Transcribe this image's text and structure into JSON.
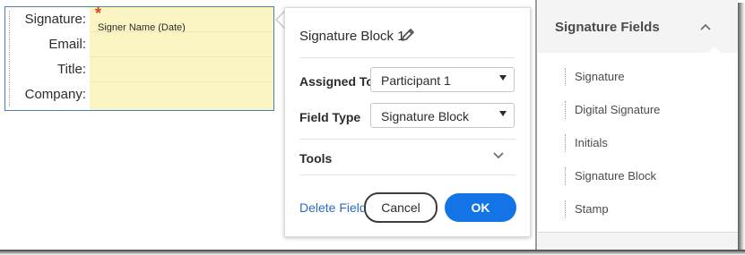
{
  "signature_block": {
    "rows": [
      {
        "label": "Signature:",
        "placeholder": "Signer Name (Date)",
        "required_marker": "*"
      },
      {
        "label": "Email:"
      },
      {
        "label": "Title:"
      },
      {
        "label": "Company:"
      }
    ]
  },
  "panel": {
    "title": "Signature Block 1",
    "assigned_to_label": "Assigned To",
    "assigned_to_value": "Participant 1",
    "field_type_label": "Field Type",
    "field_type_value": "Signature Block",
    "tools_label": "Tools",
    "delete_label": "Delete Field",
    "cancel_label": "Cancel",
    "ok_label": "OK"
  },
  "sidebar": {
    "title": "Signature Fields",
    "items": [
      {
        "label": "Signature"
      },
      {
        "label": "Digital Signature"
      },
      {
        "label": "Initials"
      },
      {
        "label": "Signature Block"
      },
      {
        "label": "Stamp"
      }
    ]
  },
  "colors": {
    "field_fill": "#fbf5c4",
    "accent_blue": "#1473e6",
    "link_blue": "#2d6bc4",
    "required_red": "#d9461f"
  }
}
